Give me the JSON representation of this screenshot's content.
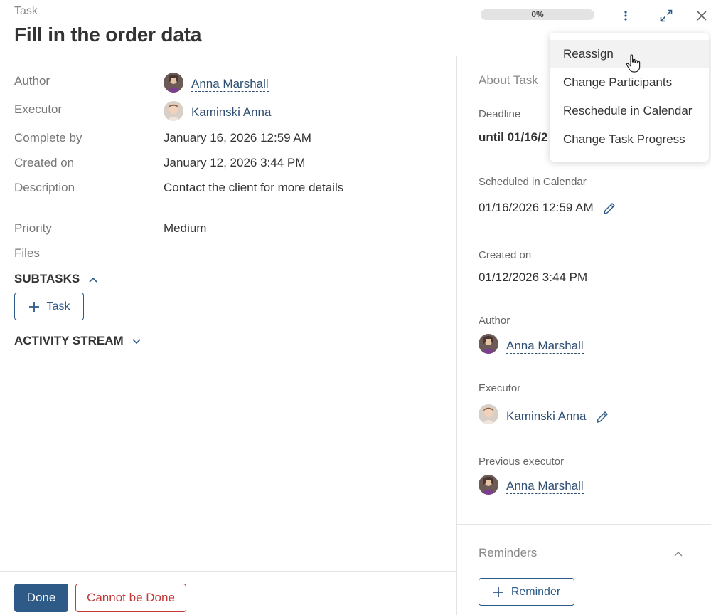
{
  "header": {
    "kicker": "Task",
    "title": "Fill in the order data",
    "progress_text": "0%",
    "progress_value": 0
  },
  "details": {
    "author_label": "Author",
    "author_name": "Anna Marshall",
    "executor_label": "Executor",
    "executor_name": "Kaminski Anna",
    "complete_by_label": "Complete by",
    "complete_by_value": "January 16, 2026 12:59 AM",
    "created_on_label": "Created on",
    "created_on_value": "January 12, 2026 3:44 PM",
    "description_label": "Description",
    "description_value": "Contact the client for more details",
    "priority_label": "Priority",
    "priority_value": "Medium",
    "files_label": "Files"
  },
  "subtasks": {
    "title": "SUBTASKS",
    "add_label": "Task"
  },
  "activity": {
    "title": "ACTIVITY STREAM"
  },
  "about": {
    "title": "About Task",
    "deadline_label": "Deadline",
    "deadline_value": "until 01/16/2",
    "scheduled_label": "Scheduled in Calendar",
    "scheduled_value": "01/16/2026 12:59 AM",
    "created_label": "Created on",
    "created_value": "01/12/2026 3:44 PM",
    "author_label": "Author",
    "author_name": "Anna Marshall",
    "executor_label": "Executor",
    "executor_name": "Kaminski Anna",
    "prev_executor_label": "Previous executor",
    "prev_executor_name": "Anna Marshall"
  },
  "reminders": {
    "title": "Reminders",
    "add_label": "Reminder"
  },
  "footer": {
    "done_label": "Done",
    "cannot_label": "Cannot be Done"
  },
  "menu": {
    "items": [
      "Reassign",
      "Change Participants",
      "Reschedule in Calendar",
      "Change Task Progress"
    ],
    "hovered_index": 0
  },
  "icons": {
    "kebab": "kebab-icon",
    "expand": "expand-icon",
    "close": "close-icon",
    "pencil": "pencil-icon",
    "plus": "plus-icon",
    "chevron": "chevron-icon",
    "cursor": "hand-cursor-icon"
  },
  "colors": {
    "accent": "#2e5a88",
    "link": "#2e4f73",
    "danger": "#c43a3a",
    "progress_track": "#e3e3e3"
  }
}
